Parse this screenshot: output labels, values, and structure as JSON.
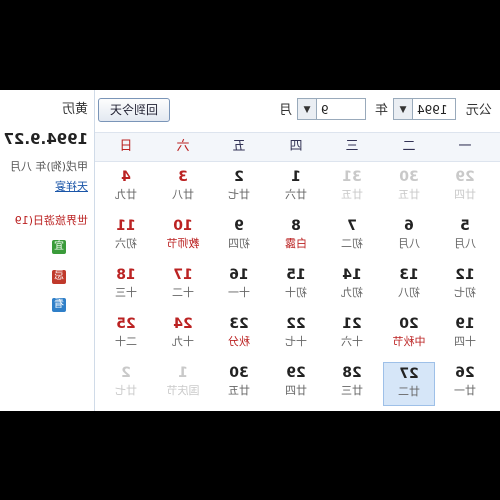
{
  "info": {
    "title": "黄历",
    "date": "1994.9.27",
    "ganzhi": "甲戌(狗)年 八月",
    "link1": "天祥宴",
    "festival": "世界旅游日(19",
    "badges": [
      {
        "label": "宜",
        "color": "#3a9b3a"
      },
      {
        "label": "忌",
        "color": "#c0392b"
      },
      {
        "label": "看",
        "color": "#2f7fc8"
      }
    ]
  },
  "toolbar": {
    "era": "公元",
    "year": "1994",
    "year_suffix": "年",
    "month": "9",
    "month_suffix": "月",
    "back_today": "回到今天",
    "dropdown_glyph": "▼"
  },
  "weekdays": [
    "一",
    "二",
    "三",
    "四",
    "五",
    "六",
    "日"
  ],
  "weeks": [
    [
      {
        "day": "29",
        "lunar": "廿四",
        "other": true
      },
      {
        "day": "30",
        "lunar": "廿五",
        "other": true
      },
      {
        "day": "31",
        "lunar": "廿五",
        "other": true
      },
      {
        "day": "1",
        "lunar": "廿六"
      },
      {
        "day": "2",
        "lunar": "廿七"
      },
      {
        "day": "3",
        "lunar": "廿八"
      },
      {
        "day": "4",
        "lunar": "廿九"
      }
    ],
    [
      {
        "day": "5",
        "lunar": "八月"
      },
      {
        "day": "6",
        "lunar": "八月"
      },
      {
        "day": "7",
        "lunar": "初二"
      },
      {
        "day": "8",
        "lunar": "白露",
        "festival": true
      },
      {
        "day": "9",
        "lunar": "初四"
      },
      {
        "day": "10",
        "lunar": "教师节",
        "festival": true
      },
      {
        "day": "11",
        "lunar": "初六"
      }
    ],
    [
      {
        "day": "12",
        "lunar": "初七"
      },
      {
        "day": "13",
        "lunar": "初八"
      },
      {
        "day": "14",
        "lunar": "初九"
      },
      {
        "day": "15",
        "lunar": "初十"
      },
      {
        "day": "16",
        "lunar": "十一"
      },
      {
        "day": "17",
        "lunar": "十二"
      },
      {
        "day": "18",
        "lunar": "十三"
      }
    ],
    [
      {
        "day": "19",
        "lunar": "十四"
      },
      {
        "day": "20",
        "lunar": "中秋节",
        "festival": true
      },
      {
        "day": "21",
        "lunar": "十六"
      },
      {
        "day": "22",
        "lunar": "十七"
      },
      {
        "day": "23",
        "lunar": "秋分",
        "festival": true
      },
      {
        "day": "24",
        "lunar": "十九"
      },
      {
        "day": "25",
        "lunar": "二十"
      }
    ],
    [
      {
        "day": "26",
        "lunar": "廿一"
      },
      {
        "day": "27",
        "lunar": "廿二",
        "today": true
      },
      {
        "day": "28",
        "lunar": "廿三"
      },
      {
        "day": "29",
        "lunar": "廿四"
      },
      {
        "day": "30",
        "lunar": "廿五"
      },
      {
        "day": "1",
        "lunar": "国庆节",
        "other": true
      },
      {
        "day": "2",
        "lunar": "廿七",
        "other": true
      }
    ]
  ]
}
